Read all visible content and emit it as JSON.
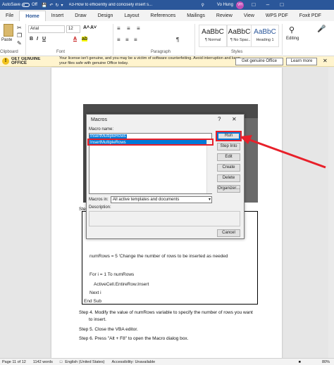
{
  "titlebar": {
    "autosave": "AutoSave",
    "autosave_state": "Off",
    "doc_title": "A3-How to efficiently and concisely insert s...",
    "user_name": "Vo Hung",
    "user_initials": "VH"
  },
  "tabs": [
    "File",
    "Home",
    "Insert",
    "Draw",
    "Design",
    "Layout",
    "References",
    "Mailings",
    "Review",
    "View",
    "WPS PDF",
    "Foxit PDF"
  ],
  "ribbon": {
    "paste_label": "Paste",
    "clipboard_label": "Clipboard",
    "font_name": "Arial",
    "font_size": "12",
    "font_label": "Font",
    "paragraph_label": "Paragraph",
    "styles_label": "Styles",
    "editing_label": "Editing",
    "styles": [
      {
        "preview": "AaBbC",
        "name": "¶ Normal"
      },
      {
        "preview": "AaBbCc",
        "name": "¶ No Spac..."
      },
      {
        "preview": "AaBbC",
        "name": "Heading 1"
      }
    ]
  },
  "license": {
    "heading": "GET GENUINE OFFICE",
    "message": "Your license isn't genuine, and you may be a victim of software counterfeiting. Avoid interruption and keep your files safe with genuine Office today.",
    "btn_genuine": "Get genuine Office",
    "btn_learn": "Learn more"
  },
  "dialog": {
    "title": "Macros",
    "help": "?",
    "close": "✕",
    "macro_name_label": "Macro name:",
    "macro_name_value": "InsertMultipleRows",
    "list_items": [
      "InsertMultipleRows"
    ],
    "macros_in_label": "Macros in:",
    "macros_in_value": "All active templates and documents",
    "description_label": "Description:",
    "buttons": {
      "run": "Run",
      "step_into": "Step Into",
      "edit": "Edit",
      "create": "Create",
      "delete": "Delete",
      "organizer": "Organizer...",
      "cancel": "Cancel"
    }
  },
  "document": {
    "step_prefix": "Step",
    "code_line1": "numRows = 5 'Change the number of rows to be inserted as needed",
    "code_line2": "For i = 1 To numRows",
    "code_line3": "ActiveCell.EntireRow.Insert",
    "code_line4": "Next i",
    "code_line5": "End Sub",
    "step4a": "Step 4. Modify the value of numRows variable to specify the number of rows you want",
    "step4b": "to insert.",
    "step5": "Step 5. Close the VBA editor.",
    "step6": "Step 6. Press \"Alt + F8\" to open the Macro dialog box."
  },
  "status": {
    "page": "Page 11 of 12",
    "words": "1142 words",
    "language": "English (United States)",
    "accessibility": "Accessibility: Unavailable",
    "zoom": "80%"
  },
  "colors": {
    "accent": "#2b579a",
    "annotation": "#e8202a",
    "selection": "#0078d7"
  }
}
